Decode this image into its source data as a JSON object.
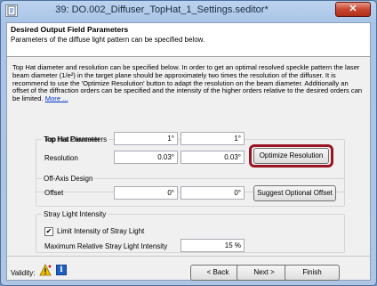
{
  "window": {
    "title": "39: DO.002_Diffuser_TopHat_1_Settings.seditor*",
    "close_glyph": "✕"
  },
  "header": {
    "title": "Desired Output Field Parameters",
    "subtitle": "Parameters of the diffuse light pattern can be specified below."
  },
  "description": {
    "text": "Top Hat diameter and resolution can be specified below. In order to get an optimal resolved speckle pattern the laser beam diameter (1/e²) in the target plane should be approximately two times the resolution of the diffuser. It is recommend to use the 'Optimize Resolution' button to adapt the resolution on the beam diameter. Additionally an offset of the diffraction orders can be specified and the intensity of the higher orders relative to the desired orders can be limited.",
    "more_link": "More ..."
  },
  "top_hat": {
    "legend": "Top Hat Parameters",
    "diameter_label": "Top Hat Diameter",
    "diameter_x": "1°",
    "diameter_y": "1°",
    "resolution_label": "Resolution",
    "resolution_x": "0.03°",
    "resolution_y": "0.03°",
    "optimize_button": "Optimize Resolution"
  },
  "off_axis": {
    "legend": "Off-Axis Design",
    "offset_label": "Offset",
    "offset_x": "0°",
    "offset_y": "0°",
    "suggest_button": "Suggest Optional Offset"
  },
  "stray_light": {
    "legend": "Stray Light Intensity",
    "limit_checkbox_label": "Limit Intensity of Stray Light",
    "limit_checked": true,
    "check_glyph": "✔",
    "max_label": "Maximum Relative Stray Light Intensity",
    "max_value": "15 %"
  },
  "footer": {
    "validity_label": "Validity:",
    "info_glyph": "i",
    "back_button": "< Back",
    "next_button": "Next >",
    "finish_button": "Finish"
  },
  "colors": {
    "highlight": "#9a1424",
    "warning": "#f2c200",
    "info": "#1f5fbf"
  },
  "icons": {
    "app": "document-icon",
    "warning": "warning-icon",
    "info": "info-icon"
  }
}
